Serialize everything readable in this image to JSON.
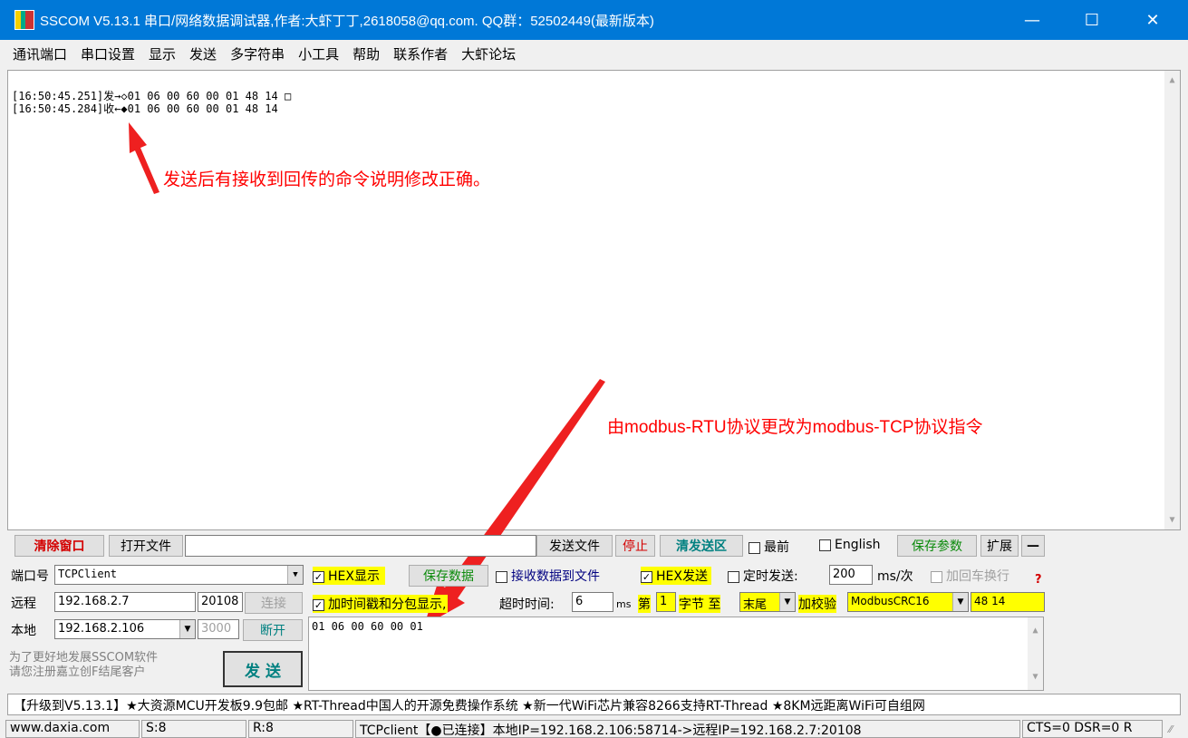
{
  "window": {
    "title": "SSCOM V5.13.1 串口/网络数据调试器,作者:大虾丁丁,2618058@qq.com. QQ群：52502449(最新版本)",
    "minimize": "—",
    "maximize": "☐",
    "close": "✕"
  },
  "menu": [
    "通讯端口",
    "串口设置",
    "显示",
    "发送",
    "多字符串",
    "小工具",
    "帮助",
    "联系作者",
    "大虾论坛"
  ],
  "receive": {
    "lines": [
      "[16:50:45.251]发→◇01 06 00 60 00 01 48 14 □",
      "[16:50:45.284]收←◆01 06 00 60 00 01 48 14"
    ]
  },
  "annotations": {
    "note1": "发送后有接收到回传的命令说明修改正确。",
    "note2": "由modbus-RTU协议更改为modbus-TCP协议指令",
    "color": "#ff0000"
  },
  "toolbar": {
    "clear_window": "清除窗口",
    "open_file": "打开文件",
    "file_path": "",
    "send_file": "发送文件",
    "stop": "停止",
    "clear_send": "清发送区",
    "topmost": "最前",
    "english": "English",
    "save_params": "保存参数",
    "expand": "扩展",
    "collapse": "—"
  },
  "connection": {
    "port_label": "端口号",
    "port_value": "TCPClient",
    "remote_label": "远程",
    "remote_ip": "192.168.2.7",
    "remote_port": "20108",
    "connect": "连接",
    "local_label": "本地",
    "local_ip": "192.168.2.106",
    "local_port": "3000",
    "disconnect": "断开",
    "promo": "为了更好地发展SSCOM软件\n请您注册嘉立创F结尾客户",
    "send": "发 送"
  },
  "options": {
    "hex_display": "HEX显示",
    "save_data": "保存数据",
    "recv_to_file": "接收数据到文件",
    "hex_send": "HEX发送",
    "timed_send": "定时发送:",
    "interval": "200",
    "interval_unit": "ms/次",
    "add_crlf": "加回车换行",
    "timestamp": "加时间戳和分包显示,",
    "timeout_label": "超时时间:",
    "timeout": "6",
    "ms": "ms",
    "byte_from": "第",
    "byte_start": "1",
    "byte_label": "字节 至",
    "byte_end": "末尾",
    "checksum_label": "加校验",
    "checksum_type": "ModbusCRC16",
    "checksum_value": "48 14",
    "question": "?"
  },
  "send_area": {
    "content": "01 06 00 60 00 01"
  },
  "ticker": "【升级到V5.13.1】★大资源MCU开发板9.9包邮 ★RT-Thread中国人的开源免费操作系统 ★新一代WiFi芯片兼容8266支持RT-Thread ★8KM远距离WiFi可自组网",
  "statusbar": {
    "website": "www.daxia.com",
    "sent": "S:8",
    "received": "R:8",
    "connection": "TCPclient【●已连接】本地IP=192.168.2.106:58714->远程IP=192.168.2.7:20108",
    "signals": "CTS=0 DSR=0 R"
  }
}
